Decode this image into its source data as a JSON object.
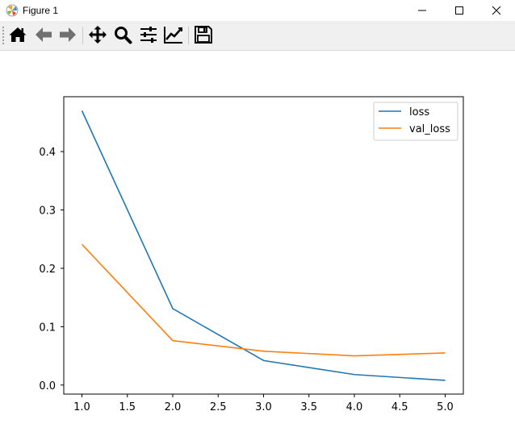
{
  "window": {
    "title": "Figure 1",
    "icons": {
      "minimize": "minimize-icon",
      "maximize": "maximize-icon",
      "close": "close-icon"
    }
  },
  "toolbar": {
    "buttons": [
      {
        "name": "home",
        "icon": "home-icon"
      },
      {
        "name": "back",
        "icon": "arrow-left-icon"
      },
      {
        "name": "forward",
        "icon": "arrow-right-icon"
      },
      {
        "name": "pan",
        "icon": "move-arrows-icon"
      },
      {
        "name": "zoom",
        "icon": "magnifier-icon"
      },
      {
        "name": "configure-subplots",
        "icon": "sliders-icon"
      },
      {
        "name": "edit-axis",
        "icon": "line-chart-icon"
      },
      {
        "name": "save",
        "icon": "floppy-disk-icon"
      }
    ]
  },
  "chart_data": {
    "type": "line",
    "title": "",
    "xlabel": "",
    "ylabel": "",
    "x": [
      1,
      2,
      3,
      4,
      5
    ],
    "series": [
      {
        "name": "loss",
        "color": "#1f77b4",
        "values": [
          0.47,
          0.131,
          0.042,
          0.018,
          0.008
        ]
      },
      {
        "name": "val_loss",
        "color": "#ff7f0e",
        "values": [
          0.241,
          0.076,
          0.058,
          0.05,
          0.055
        ]
      }
    ],
    "xlim": [
      0.8,
      5.2
    ],
    "ylim": [
      -0.0155,
      0.494
    ],
    "xticks": [
      1.0,
      1.5,
      2.0,
      2.5,
      3.0,
      3.5,
      4.0,
      4.5,
      5.0
    ],
    "xtick_labels": [
      "1.0",
      "1.5",
      "2.0",
      "2.5",
      "3.0",
      "3.5",
      "4.0",
      "4.5",
      "5.0"
    ],
    "yticks": [
      0.0,
      0.1,
      0.2,
      0.3,
      0.4
    ],
    "ytick_labels": [
      "0.0",
      "0.1",
      "0.2",
      "0.3",
      "0.4"
    ],
    "legend": {
      "placement": "top-right",
      "entries": [
        "loss",
        "val_loss"
      ]
    },
    "grid": false
  }
}
